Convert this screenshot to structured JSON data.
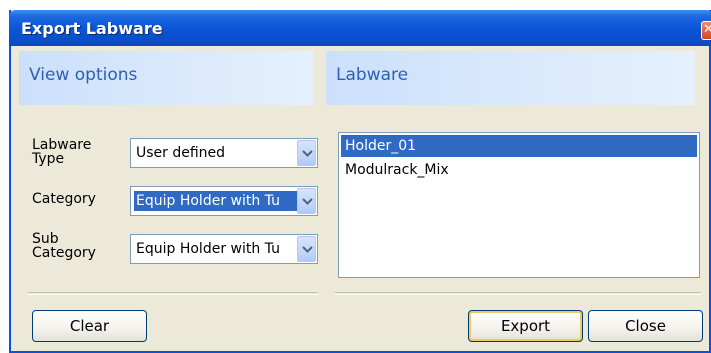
{
  "window": {
    "title": "Export Labware",
    "close_glyph": "✕"
  },
  "view_options": {
    "header": "View options",
    "labware_type_label": "Labware Type",
    "labware_type_value": "User defined",
    "category_label": "Category",
    "category_value": "Equip Holder with Tu",
    "sub_category_label": "Sub Category",
    "sub_category_value": "Equip Holder with Tu"
  },
  "labware": {
    "header": "Labware",
    "items": [
      {
        "label": "Holder_01",
        "selected": true
      },
      {
        "label": "Modulrack_Mix",
        "selected": false
      }
    ]
  },
  "buttons": {
    "clear": "Clear",
    "export": "Export",
    "close": "Close"
  },
  "colors": {
    "title_bar": "#0a56d6",
    "selection": "#316ac5",
    "panel_header_text": "#2d5fb7"
  },
  "icons": {
    "combo_arrow": "chevron-down-icon",
    "window_close": "close-icon"
  }
}
